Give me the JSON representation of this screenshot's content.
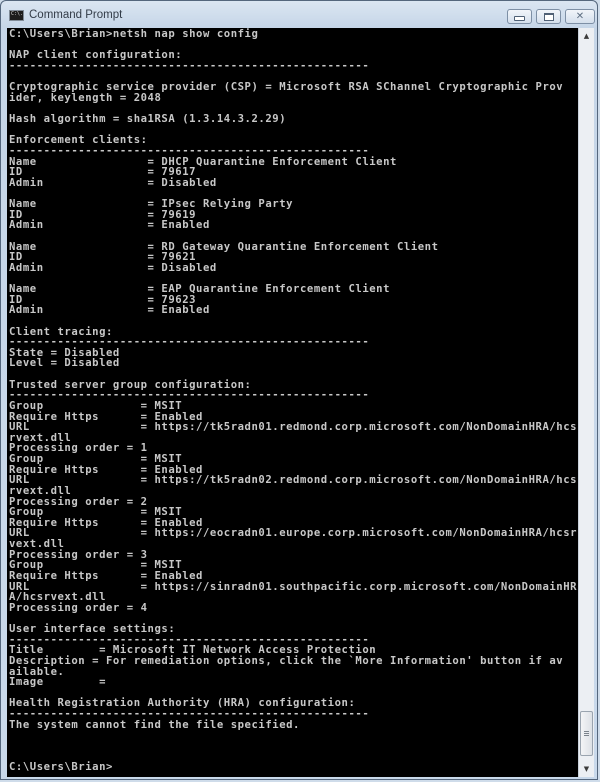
{
  "window": {
    "title": "Command Prompt",
    "icon": "cmd-icon",
    "icon_text": "C:\\.",
    "controls": {
      "minimize": "minimize-icon",
      "maximize": "maximize-icon",
      "close": "close-icon"
    }
  },
  "console": {
    "lines": [
      "C:\\Users\\Brian>netsh nap show config",
      "",
      "NAP client configuration:",
      "----------------------------------------------------",
      "",
      "Cryptographic service provider (CSP) = Microsoft RSA SChannel Cryptographic Prov",
      "ider, keylength = 2048",
      "",
      "Hash algorithm = sha1RSA (1.3.14.3.2.29)",
      "",
      "Enforcement clients:",
      "----------------------------------------------------",
      "Name                = DHCP Quarantine Enforcement Client",
      "ID                  = 79617",
      "Admin               = Disabled",
      "",
      "Name                = IPsec Relying Party",
      "ID                  = 79619",
      "Admin               = Enabled",
      "",
      "Name                = RD Gateway Quarantine Enforcement Client",
      "ID                  = 79621",
      "Admin               = Disabled",
      "",
      "Name                = EAP Quarantine Enforcement Client",
      "ID                  = 79623",
      "Admin               = Enabled",
      "",
      "Client tracing:",
      "----------------------------------------------------",
      "State = Disabled",
      "Level = Disabled",
      "",
      "Trusted server group configuration:",
      "----------------------------------------------------",
      "Group              = MSIT",
      "Require Https      = Enabled",
      "URL                = https://tk5radn01.redmond.corp.microsoft.com/NonDomainHRA/hcs",
      "rvext.dll",
      "Processing order = 1",
      "Group              = MSIT",
      "Require Https      = Enabled",
      "URL                = https://tk5radn02.redmond.corp.microsoft.com/NonDomainHRA/hcs",
      "rvext.dll",
      "Processing order = 2",
      "Group              = MSIT",
      "Require Https      = Enabled",
      "URL                = https://eocradn01.europe.corp.microsoft.com/NonDomainHRA/hcsr",
      "vext.dll",
      "Processing order = 3",
      "Group              = MSIT",
      "Require Https      = Enabled",
      "URL                = https://sinradn01.southpacific.corp.microsoft.com/NonDomainHR",
      "A/hcsrvext.dll",
      "Processing order = 4",
      "",
      "User interface settings:",
      "----------------------------------------------------",
      "Title        = Microsoft IT Network Access Protection",
      "Description = For remediation options, click the `More Information' button if av",
      "ailable.",
      "Image        =",
      "",
      "Health Registration Authority (HRA) configuration:",
      "----------------------------------------------------",
      "The system cannot find the file specified.",
      "",
      "",
      "",
      "C:\\Users\\Brian>"
    ]
  },
  "scrollbar": {
    "up_icon": "scroll-up-arrow-icon",
    "down_icon": "scroll-down-arrow-icon",
    "position": "bottom"
  }
}
